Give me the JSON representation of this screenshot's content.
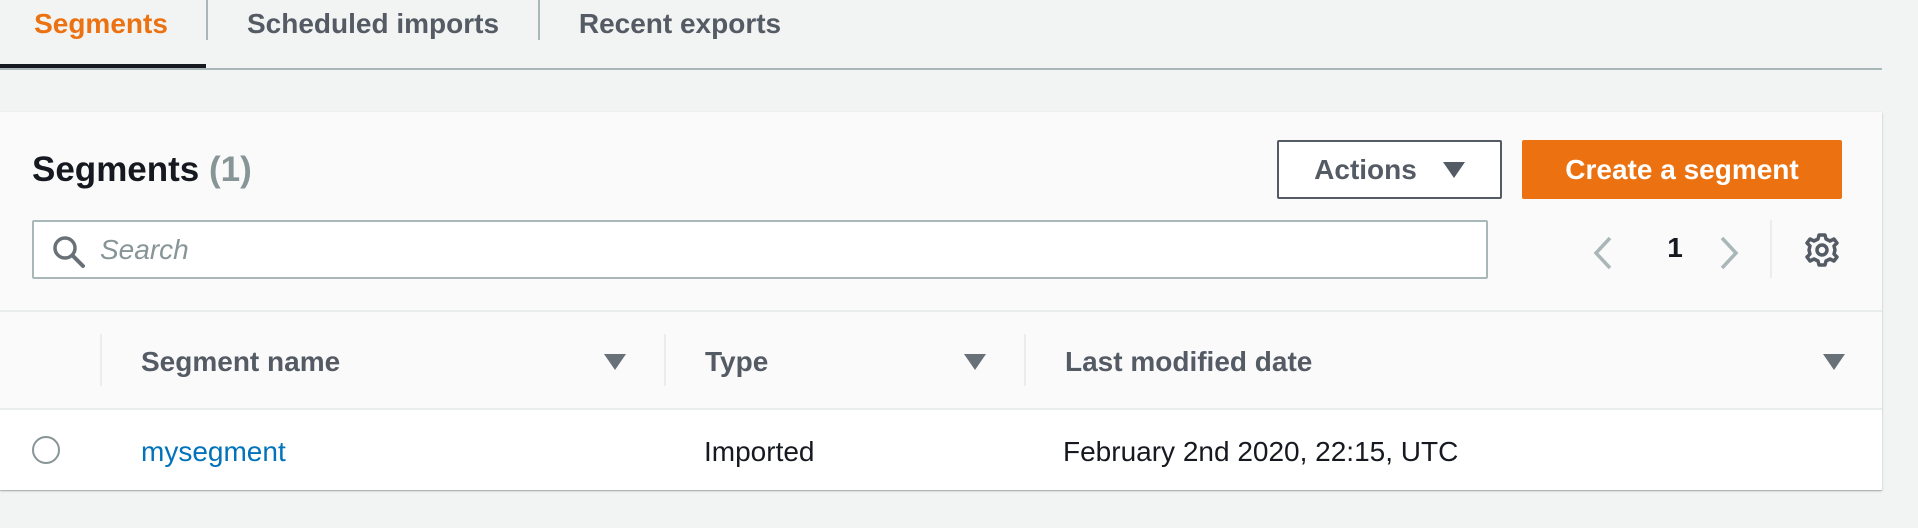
{
  "tabs": [
    {
      "label": "Segments",
      "active": true
    },
    {
      "label": "Scheduled imports",
      "active": false
    },
    {
      "label": "Recent exports",
      "active": false
    }
  ],
  "panel": {
    "title": "Segments",
    "count": "(1)",
    "actions_label": "Actions",
    "create_label": "Create a segment",
    "search_placeholder": "Search",
    "search_value": "",
    "page_number": "1"
  },
  "table": {
    "columns": [
      "Segment name",
      "Type",
      "Last modified date"
    ],
    "rows": [
      {
        "name": "mysegment",
        "type": "Imported",
        "modified": "February 2nd 2020, 22:15, UTC",
        "selected": false
      }
    ]
  },
  "colors": {
    "accent": "#ec7211",
    "link": "#0073bb",
    "text": "#16191f",
    "muted": "#879596"
  },
  "icons": [
    "search-icon",
    "chevron-left-icon",
    "chevron-right-icon",
    "gear-icon",
    "caret-down-icon"
  ]
}
